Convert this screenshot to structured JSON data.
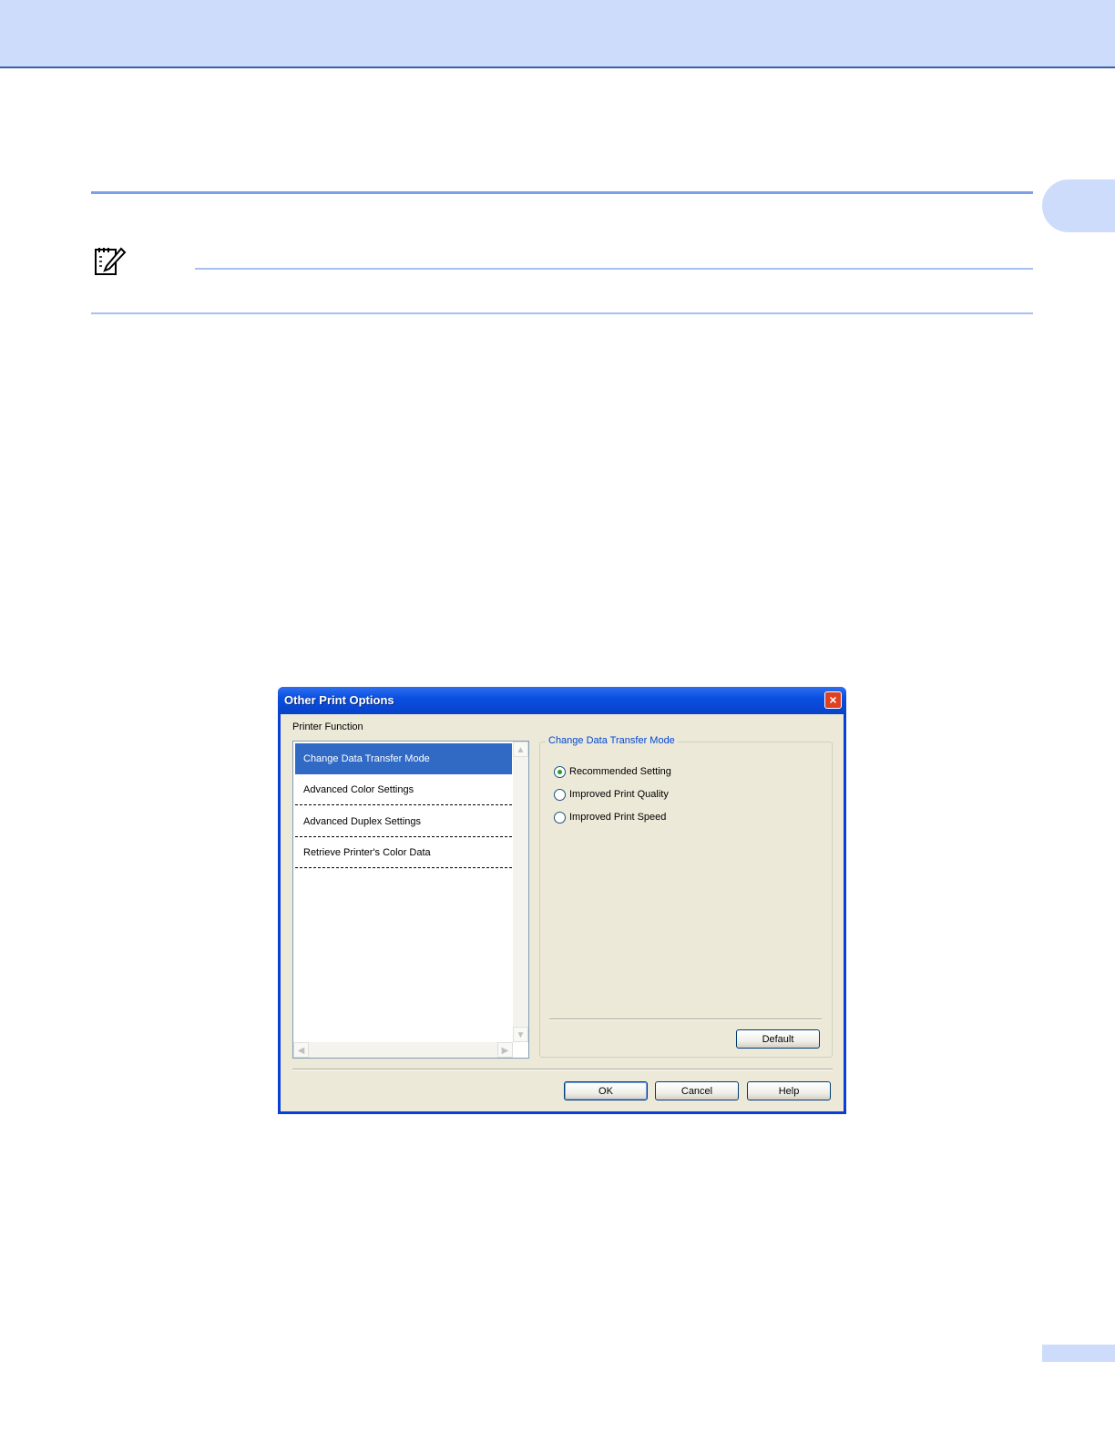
{
  "dialog": {
    "title": "Other Print Options",
    "close_symbol": "×",
    "printer_function_label": "Printer Function",
    "functions": [
      "Change Data Transfer Mode",
      "Advanced Color Settings",
      "Advanced Duplex Settings",
      "Retrieve Printer's Color Data"
    ],
    "selected_function": "Change Data Transfer Mode",
    "group_title": "Change Data Transfer Mode",
    "options": [
      "Recommended Setting",
      "Improved Print Quality",
      "Improved Print Speed"
    ],
    "selected_option": "Recommended Setting",
    "default_button": "Default",
    "ok_button": "OK",
    "cancel_button": "Cancel",
    "help_button": "Help"
  },
  "icons": {
    "note": "note-pencil-icon",
    "close": "close-icon",
    "scroll_up": "scroll-up-arrow-icon",
    "scroll_down": "scroll-down-arrow-icon",
    "scroll_left": "scroll-left-arrow-icon",
    "scroll_right": "scroll-right-arrow-icon"
  },
  "colors": {
    "header_band": "#cddcfb",
    "header_rule": "#3c5fa8",
    "section_rule": "#7d9fe6",
    "selection": "#316ac5",
    "group_title": "#0046d5"
  }
}
